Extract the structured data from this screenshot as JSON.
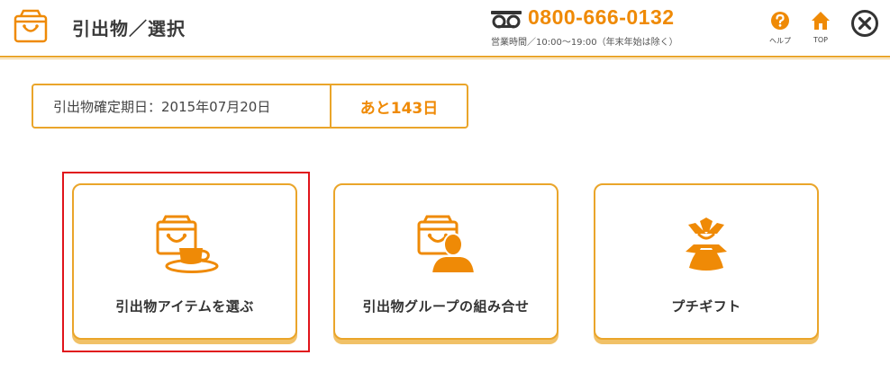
{
  "header": {
    "title": "引出物／選択",
    "phone_number": "0800-666-0132",
    "hours": "営業時間／10:00〜19:00（年末年始は除く）",
    "help_label": "ヘルプ",
    "top_label": "TOP",
    "icons": {
      "logo": "shopping-bag-icon",
      "phone": "free-dial-icon",
      "help": "question-icon",
      "top": "home-icon",
      "close": "close-icon"
    }
  },
  "date_info": {
    "label": "引出物確定期日：2015年07月20日",
    "remaining": "あと143日"
  },
  "options": [
    {
      "label": "引出物アイテムを選ぶ",
      "icon": "bag-with-cup-icon",
      "selected": true
    },
    {
      "label": "引出物グループの組み合せ",
      "icon": "bag-with-person-icon",
      "selected": false
    },
    {
      "label": "プチギフト",
      "icon": "petit-gift-icon",
      "selected": false
    }
  ],
  "colors": {
    "accent": "#ef8a06",
    "border": "#eaa52a",
    "selection": "#e0141b"
  }
}
